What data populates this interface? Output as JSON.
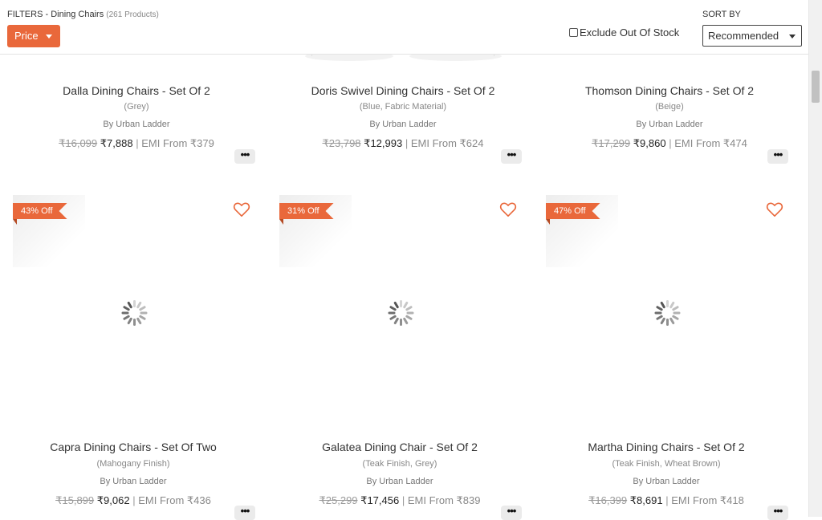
{
  "filter_bar": {
    "label": "FILTERS - Dining Chairs",
    "count": "(261 Products)",
    "price_button": "Price",
    "exclude_label": "Exclude Out Of Stock",
    "exclude_checked": false,
    "sort_label": "SORT BY",
    "sort_value": "Recommended"
  },
  "colors": {
    "accent": "#e9683b",
    "text": "#333333",
    "muted": "#888888"
  },
  "products_top": [
    {
      "name": "Dalla Dining Chairs - Set Of 2",
      "variant": "(Grey)",
      "brand": "By Urban Ladder",
      "mrp": "₹16,099",
      "price": "₹7,888",
      "emi": "EMI From ₹379"
    },
    {
      "name": "Doris Swivel Dining Chairs - Set Of 2",
      "variant": "(Blue, Fabric Material)",
      "brand": "By Urban Ladder",
      "mrp": "₹23,798",
      "price": "₹12,993",
      "emi": "EMI From ₹624"
    },
    {
      "name": "Thomson Dining Chairs - Set Of 2",
      "variant": "(Beige)",
      "brand": "By Urban Ladder",
      "mrp": "₹17,299",
      "price": "₹9,860",
      "emi": "EMI From ₹474"
    }
  ],
  "products_bottom": [
    {
      "discount": "43% Off",
      "name": "Capra Dining Chairs - Set Of Two",
      "variant": "(Mahogany Finish)",
      "brand": "By Urban Ladder",
      "mrp": "₹15,899",
      "price": "₹9,062",
      "emi": "EMI From ₹436"
    },
    {
      "discount": "31% Off",
      "name": "Galatea Dining Chair - Set Of 2",
      "variant": "(Teak Finish, Grey)",
      "brand": "By Urban Ladder",
      "mrp": "₹25,299",
      "price": "₹17,456",
      "emi": "EMI From ₹839"
    },
    {
      "discount": "47% Off",
      "name": "Martha Dining Chairs - Set Of 2",
      "variant": "(Teak Finish, Wheat Brown)",
      "brand": "By Urban Ladder",
      "mrp": "₹16,399",
      "price": "₹8,691",
      "emi": "EMI From ₹418"
    }
  ],
  "icons": {
    "wishlist": "heart-outline-icon",
    "loading": "spinner-icon",
    "more": "more-options-icon"
  },
  "separator": "|"
}
